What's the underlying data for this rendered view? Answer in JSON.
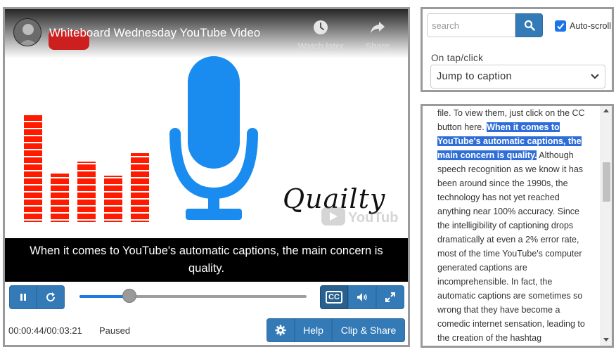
{
  "video": {
    "title": "Whiteboard Wednesday YouTube Video",
    "watch_later_label": "Watch later",
    "share_label": "Share",
    "quality_text": "Quailty",
    "youtube_logo_text": "YouTube"
  },
  "caption": {
    "text": "When it comes to YouTube's automatic captions, the main concern is quality."
  },
  "controls": {
    "time": "00:00:44/00:03:21",
    "status": "Paused",
    "progress_fraction": 0.22,
    "help_label": "Help",
    "clip_share_label": "Clip & Share",
    "cc_label": "CC"
  },
  "search": {
    "placeholder": "search",
    "autoscroll_label": "Auto-scroll",
    "autoscroll_checked": true,
    "tap_label": "On tap/click",
    "tap_selected": "Jump to caption"
  },
  "transcript": {
    "before": "file. To view them, just click on the CC button here. ",
    "highlight": "When it comes to YouTube's automatic captions, the main concern is quality.",
    "after": " Although speech recognition as we know it has been around since the 1990s, the technology has not yet reached anything near 100% accuracy. Since the intelligibility of captioning drops dramatically at even a 2% error rate, most of the time YouTube's computer generated captions are incomprehensible. In fact, the automatic captions are sometimes so wrong that they have become a comedic internet sensation, leading to the creation of the hashtag"
  },
  "colors": {
    "button_blue": "#337ab7",
    "highlight_blue": "#2f6ed8",
    "mic_blue": "#1a8cf0",
    "bar_red": "#ff1a00"
  }
}
